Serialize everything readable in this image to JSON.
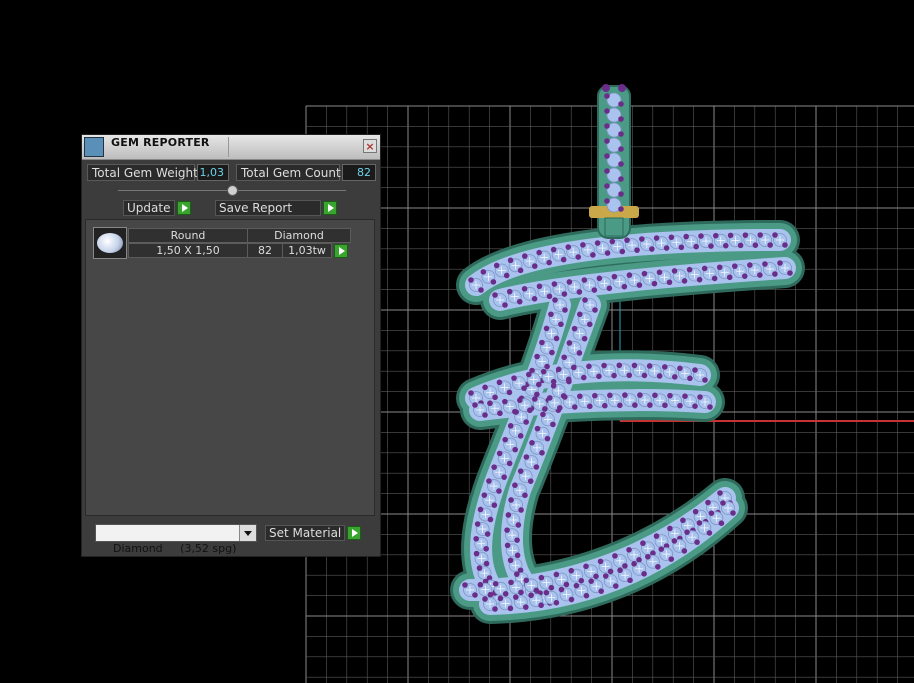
{
  "window": {
    "title": "GEM REPORTER",
    "close_glyph": "×"
  },
  "stats": {
    "total_weight_label": "Total Gem Weight",
    "total_weight_value": "1,03",
    "total_count_label": "Total Gem Count",
    "total_count_value": "82"
  },
  "buttons": {
    "update": "Update",
    "save_report": "Save Report",
    "set_material": "Set Material"
  },
  "gem_table": {
    "rows": [
      {
        "shape": "Round",
        "material": "Diamond",
        "size": "1,50 X 1,50",
        "count": "82",
        "weight": "1,03tw"
      }
    ]
  },
  "material_select": {
    "value": "Diamond     (3,52 spg)"
  },
  "viewport": {
    "grid_color": "#5a5a5a",
    "axis_x_color": "#c83232",
    "axis_y_color": "#2aa8b8",
    "metal_color": "#4a9a86",
    "gem_seat_color": "#a9c3ee",
    "prong_color": "#6a2d8a",
    "bail_color": "#c9a84a"
  },
  "icons": [
    "gem-reporter-app-icon",
    "close-icon",
    "play-arrow-icon",
    "round-gem-icon",
    "dropdown-arrow-icon"
  ]
}
